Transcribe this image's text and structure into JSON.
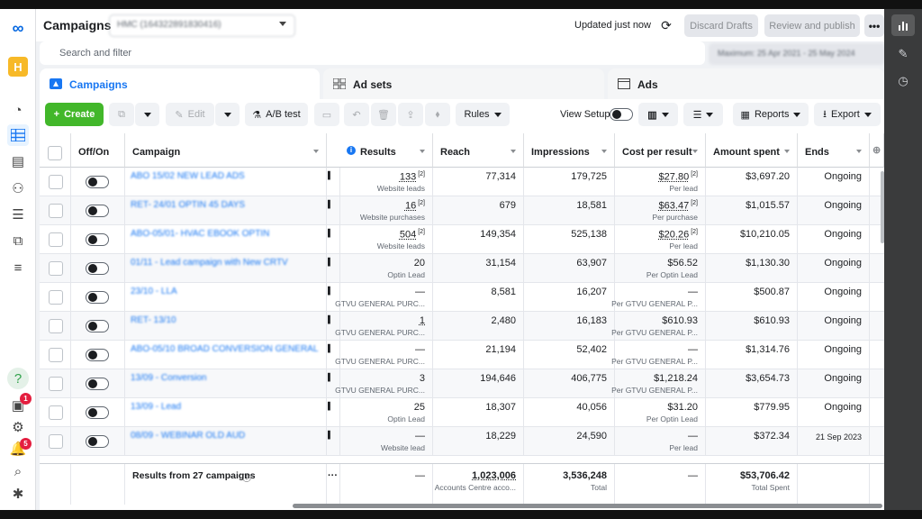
{
  "header": {
    "title": "Campaigns",
    "account": "HMC (164322891830416)",
    "updated": "Updated just now",
    "discard": "Discard Drafts",
    "review": "Review and publish",
    "more": "•••"
  },
  "search": {
    "placeholder": "Search and filter",
    "date_range": "Maximum: 25 Apr 2021 - 25 May 2024"
  },
  "tabs": {
    "campaigns": "Campaigns",
    "adsets": "Ad sets",
    "ads": "Ads"
  },
  "toolbar": {
    "create": "Create",
    "edit": "Edit",
    "abtest": "A/B test",
    "rules": "Rules",
    "view_setup": "View Setup",
    "reports": "Reports",
    "export": "Export"
  },
  "columns": {
    "offon": "Off/On",
    "campaign": "Campaign",
    "results": "Results",
    "reach": "Reach",
    "impressions": "Impressions",
    "cpr": "Cost per result",
    "spent": "Amount spent",
    "ends": "Ends"
  },
  "rows": [
    {
      "name": "ABO 15/02 NEW LEAD ADS",
      "results": "133",
      "results_note": "[2]",
      "results_sub": "Website leads",
      "reach": "77,314",
      "impressions": "179,725",
      "cpr": "$27.80",
      "cpr_note": "[2]",
      "cpr_sub": "Per lead",
      "spent": "$3,697.20",
      "ends": "Ongoing"
    },
    {
      "name": "RET- 24/01 OPTIN 45 DAYS",
      "results": "16",
      "results_note": "[2]",
      "results_sub": "Website purchases",
      "reach": "679",
      "impressions": "18,581",
      "cpr": "$63.47",
      "cpr_note": "[2]",
      "cpr_sub": "Per purchase",
      "spent": "$1,015.57",
      "ends": "Ongoing"
    },
    {
      "name": "ABO-05/01- HVAC EBOOK OPTIN",
      "results": "504",
      "results_note": "[2]",
      "results_sub": "Website leads",
      "reach": "149,354",
      "impressions": "525,138",
      "cpr": "$20.26",
      "cpr_note": "[2]",
      "cpr_sub": "Per lead",
      "spent": "$10,210.05",
      "ends": "Ongoing"
    },
    {
      "name": "01/11 - Lead campaign with New CRTV",
      "results": "20",
      "results_note": "",
      "results_sub": "Optin Lead",
      "reach": "31,154",
      "impressions": "63,907",
      "cpr": "$56.52",
      "cpr_note": "",
      "cpr_sub": "Per Optin Lead",
      "spent": "$1,130.30",
      "ends": "Ongoing"
    },
    {
      "name": "23/10 - LLA",
      "results": "—",
      "results_note": "",
      "results_sub": "GTVU GENERAL PURC...",
      "reach": "8,581",
      "impressions": "16,207",
      "cpr": "—",
      "cpr_note": "",
      "cpr_sub": "Per GTVU GENERAL P...",
      "spent": "$500.87",
      "ends": "Ongoing"
    },
    {
      "name": "RET- 13/10",
      "results": "1",
      "results_note": "",
      "results_sub": "GTVU GENERAL PURC...",
      "reach": "2,480",
      "impressions": "16,183",
      "cpr": "$610.93",
      "cpr_note": "",
      "cpr_sub": "Per GTVU GENERAL P...",
      "spent": "$610.93",
      "ends": "Ongoing"
    },
    {
      "name": "ABO-05/10 BROAD CONVERSION GENERAL",
      "results": "—",
      "results_note": "",
      "results_sub": "GTVU GENERAL PURC...",
      "reach": "21,194",
      "impressions": "52,402",
      "cpr": "—",
      "cpr_note": "",
      "cpr_sub": "Per GTVU GENERAL P...",
      "spent": "$1,314.76",
      "ends": "Ongoing"
    },
    {
      "name": "13/09 - Conversion",
      "results": "3",
      "results_note": "",
      "results_sub": "GTVU GENERAL PURC...",
      "reach": "194,646",
      "impressions": "406,775",
      "cpr": "$1,218.24",
      "cpr_note": "",
      "cpr_sub": "Per GTVU GENERAL P...",
      "spent": "$3,654.73",
      "ends": "Ongoing"
    },
    {
      "name": "13/09 - Lead",
      "results": "25",
      "results_note": "",
      "results_sub": "Optin Lead",
      "reach": "18,307",
      "impressions": "40,056",
      "cpr": "$31.20",
      "cpr_note": "",
      "cpr_sub": "Per Optin Lead",
      "spent": "$779.95",
      "ends": "Ongoing"
    },
    {
      "name": "08/09 - WEBINAR OLD AUD",
      "results": "—",
      "results_note": "",
      "results_sub": "Website lead",
      "reach": "18,229",
      "impressions": "24,590",
      "cpr": "—",
      "cpr_note": "",
      "cpr_sub": "Per lead",
      "spent": "$372.34",
      "ends": "21 Sep 2023"
    }
  ],
  "summary": {
    "label": "Results from 27 campaigns",
    "results": "—",
    "reach": "1,023,006",
    "reach_sub": "Accounts Centre acco...",
    "impressions": "3,536,248",
    "impressions_sub": "Total",
    "cpr": "—",
    "spent": "$53,706.42",
    "spent_sub": "Total Spent"
  },
  "badges": {
    "notifications_a": "1",
    "notifications_b": "5"
  },
  "colors": {
    "accent": "#1877f2",
    "create": "#42b72a",
    "badge": "#e41e3f"
  }
}
